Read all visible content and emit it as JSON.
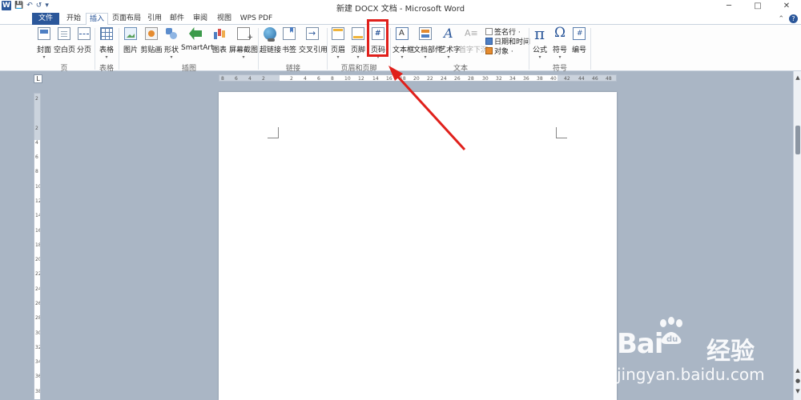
{
  "window": {
    "title": "新建 DOCX 文档 - Microsoft Word",
    "qat_icons": [
      "word-logo-icon",
      "save-icon",
      "undo-icon",
      "redo-icon",
      "customize-qat-icon"
    ],
    "qat_word_logo": "W",
    "controls": {
      "minimize": "─",
      "maximize": "□",
      "close": "✕"
    }
  },
  "tabs": {
    "file": "文件",
    "home": "开始",
    "insert": "插入",
    "page_layout": "页面布局",
    "references": "引用",
    "mailings": "邮件",
    "review": "审阅",
    "view": "视图",
    "wps_pdf": "WPS PDF",
    "active": "insert",
    "collapse_ribbon": "⌃",
    "help": "?"
  },
  "ribbon": {
    "pages": {
      "group": "页",
      "cover": "封面",
      "blank_page": "空白页",
      "page_break": "分页"
    },
    "tables": {
      "group": "表格",
      "table": "表格"
    },
    "illustrations": {
      "group": "插图",
      "picture": "图片",
      "clip_art": "剪贴画",
      "shapes": "形状",
      "smartart": "SmartArt",
      "chart": "图表",
      "screenshot": "屏幕截图"
    },
    "links": {
      "group": "链接",
      "hyperlink": "超链接",
      "bookmark": "书签",
      "cross_reference": "交叉引用"
    },
    "header_footer": {
      "group": "页眉和页脚",
      "header": "页眉",
      "footer": "页脚",
      "page_number": "页码"
    },
    "text": {
      "group": "文本",
      "text_box": "文本框",
      "quick_parts": "文档部件",
      "wordart": "艺术字",
      "drop_cap": "首字下沉",
      "signature_line": "签名行 ·",
      "date_time": "日期和时间",
      "object": "对象 ·"
    },
    "symbols": {
      "group": "符号",
      "equation": "公式",
      "symbol": "符号",
      "number": "编号"
    },
    "dropdown_glyph": "▾"
  },
  "ruler": {
    "corner": "L",
    "h_ticks": [
      "8",
      "6",
      "4",
      "2",
      "",
      "2",
      "4",
      "6",
      "8",
      "10",
      "12",
      "14",
      "16",
      "18",
      "20",
      "22",
      "24",
      "26",
      "28",
      "30",
      "32",
      "34",
      "36",
      "38",
      "40",
      "42",
      "44",
      "46",
      "48"
    ],
    "v_ticks": [
      "2",
      "",
      "2",
      "4",
      "6",
      "8",
      "10",
      "12",
      "14",
      "16",
      "18",
      "20",
      "22",
      "24",
      "26",
      "28",
      "30",
      "32",
      "34",
      "36",
      "38"
    ]
  },
  "scrollbar": {
    "up": "▲",
    "prev_page": "▲",
    "select_browse": "●",
    "next_page": "▼"
  },
  "watermark": {
    "logo": "Bai",
    "logo_cn": "经验",
    "url": "jingyan.baidu.com"
  },
  "colors": {
    "accent": "#2b579a",
    "highlight": "#e0201b",
    "workspace": "#aab6c5"
  }
}
